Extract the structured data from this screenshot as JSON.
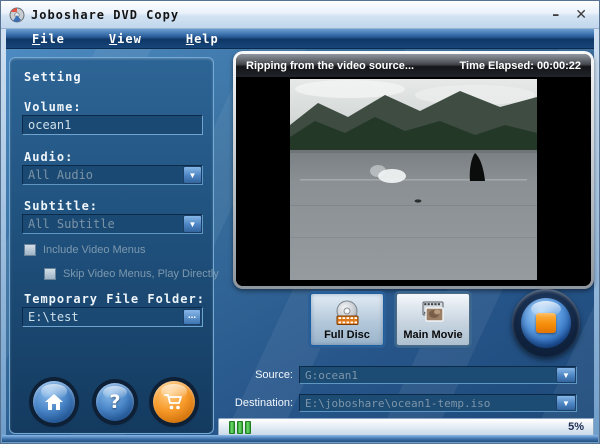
{
  "window": {
    "title": "Joboshare DVD Copy"
  },
  "icons": {
    "minimize_glyph": "–",
    "close_glyph": "✕",
    "dropdown_glyph": "▼",
    "help_glyph": "?"
  },
  "menu": {
    "items": [
      {
        "initial": "F",
        "rest": "ile"
      },
      {
        "initial": "V",
        "rest": "iew"
      },
      {
        "initial": "H",
        "rest": "elp"
      }
    ]
  },
  "settings": {
    "title": "Setting",
    "volume_label": "Volume:",
    "volume_value": "ocean1",
    "audio_label": "Audio:",
    "audio_value": "All Audio",
    "subtitle_label": "Subtitle:",
    "subtitle_value": "All Subtitle",
    "include_menus_label": "Include Video Menus",
    "skip_menus_label": "Skip Video Menus, Play Directly",
    "temp_folder_label": "Temporary File Folder:",
    "temp_folder_value": "E:\\test",
    "browse_label": "..."
  },
  "preview": {
    "status_text": "Ripping from the video source...",
    "time_elapsed_label": "Time Elapsed:",
    "time_elapsed_value": "00:00:22"
  },
  "mode_buttons": {
    "full_disc_label": "Full Disc",
    "main_movie_label": "Main Movie"
  },
  "output": {
    "source_label": "Source:",
    "source_value": "G:ocean1",
    "destination_label": "Destination:",
    "destination_value": "E:\\joboshare\\ocean1-temp.iso"
  },
  "status_bar": {
    "progress_percent": "5%"
  },
  "colors": {
    "accent_orange": "#f78f0a",
    "progress_green": "#4fc24f",
    "panel_blue": "#1d4d78",
    "menu_navy": "#0f3766"
  }
}
